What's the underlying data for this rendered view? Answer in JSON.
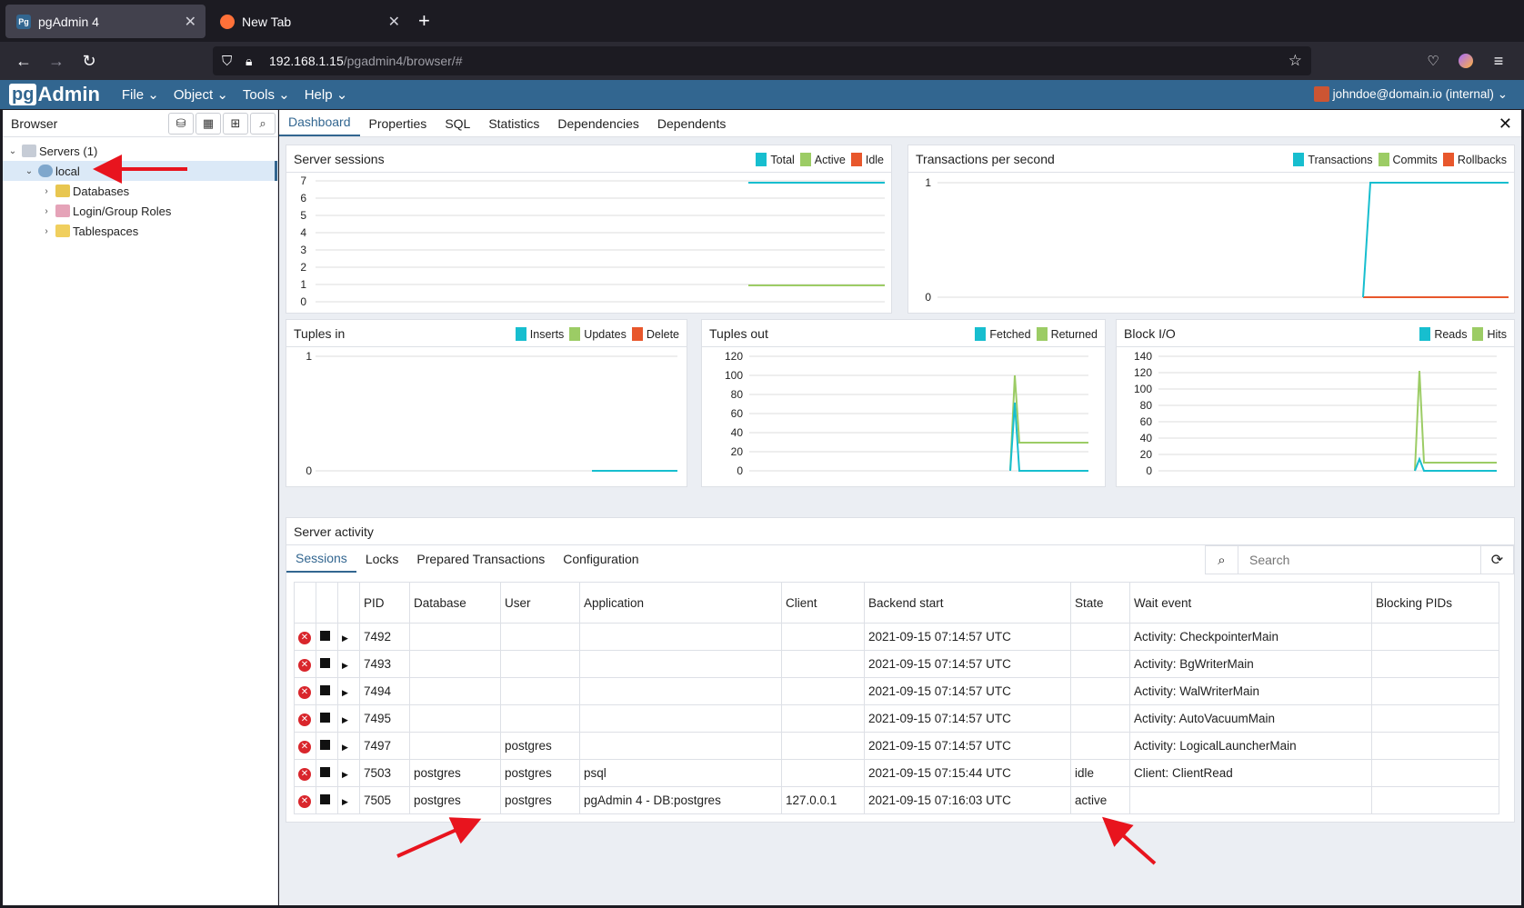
{
  "firefox": {
    "tabs": [
      {
        "label": "pgAdmin 4",
        "favicon": "Pg"
      },
      {
        "label": "New Tab",
        "favicon": ""
      }
    ],
    "url_host": "192.168.1.15",
    "url_path": "/pgadmin4/browser/#"
  },
  "header": {
    "logo_pg": "pg",
    "logo_admin": "Admin",
    "menu": [
      "File",
      "Object",
      "Tools",
      "Help"
    ],
    "user": "johndoe@domain.io (internal)"
  },
  "browser": {
    "title": "Browser",
    "tree": [
      {
        "label": "Servers (1)",
        "level": 0,
        "expanded": true
      },
      {
        "label": "local",
        "level": 1,
        "expanded": true,
        "selected": true
      },
      {
        "label": "Databases",
        "level": 2,
        "expanded": false
      },
      {
        "label": "Login/Group Roles",
        "level": 2,
        "expanded": false
      },
      {
        "label": "Tablespaces",
        "level": 2,
        "expanded": false
      }
    ]
  },
  "main_tabs": [
    "Dashboard",
    "Properties",
    "SQL",
    "Statistics",
    "Dependencies",
    "Dependents"
  ],
  "colors": {
    "teal": "#17becf",
    "green": "#9ccc65",
    "orange": "#e8572c",
    "brand": "#326690"
  },
  "charts": {
    "server_sessions": {
      "title": "Server sessions",
      "legend": [
        "Total",
        "Active",
        "Idle"
      ],
      "yticks": [
        "7",
        "6",
        "5",
        "4",
        "3",
        "2",
        "1",
        "0"
      ]
    },
    "tps": {
      "title": "Transactions per second",
      "legend": [
        "Transactions",
        "Commits",
        "Rollbacks"
      ],
      "yticks": [
        "1",
        "0"
      ]
    },
    "tuples_in": {
      "title": "Tuples in",
      "legend": [
        "Inserts",
        "Updates",
        "Delete"
      ],
      "yticks": [
        "1",
        "0"
      ]
    },
    "tuples_out": {
      "title": "Tuples out",
      "legend": [
        "Fetched",
        "Returned"
      ],
      "yticks": [
        "120",
        "100",
        "80",
        "60",
        "40",
        "20",
        "0"
      ]
    },
    "block_io": {
      "title": "Block I/O",
      "legend": [
        "Reads",
        "Hits"
      ],
      "yticks": [
        "140",
        "120",
        "100",
        "80",
        "60",
        "40",
        "20",
        "0"
      ]
    }
  },
  "activity": {
    "title": "Server activity",
    "tabs": [
      "Sessions",
      "Locks",
      "Prepared Transactions",
      "Configuration"
    ],
    "search_placeholder": "Search",
    "columns": [
      "PID",
      "Database",
      "User",
      "Application",
      "Client",
      "Backend start",
      "State",
      "Wait event",
      "Blocking PIDs"
    ],
    "rows": [
      [
        "7492",
        "",
        "",
        "",
        "",
        "2021-09-15 07:14:57 UTC",
        "",
        "Activity: CheckpointerMain",
        ""
      ],
      [
        "7493",
        "",
        "",
        "",
        "",
        "2021-09-15 07:14:57 UTC",
        "",
        "Activity: BgWriterMain",
        ""
      ],
      [
        "7494",
        "",
        "",
        "",
        "",
        "2021-09-15 07:14:57 UTC",
        "",
        "Activity: WalWriterMain",
        ""
      ],
      [
        "7495",
        "",
        "",
        "",
        "",
        "2021-09-15 07:14:57 UTC",
        "",
        "Activity: AutoVacuumMain",
        ""
      ],
      [
        "7497",
        "",
        "postgres",
        "",
        "",
        "2021-09-15 07:14:57 UTC",
        "",
        "Activity: LogicalLauncherMain",
        ""
      ],
      [
        "7503",
        "postgres",
        "postgres",
        "psql",
        "",
        "2021-09-15 07:15:44 UTC",
        "idle",
        "Client: ClientRead",
        ""
      ],
      [
        "7505",
        "postgres",
        "postgres",
        "pgAdmin 4 - DB:postgres",
        "127.0.0.1",
        "2021-09-15 07:16:03 UTC",
        "active",
        "",
        ""
      ]
    ]
  }
}
